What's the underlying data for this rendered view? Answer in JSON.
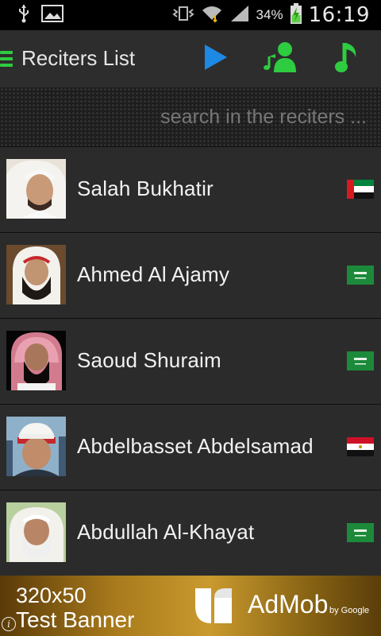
{
  "status_bar": {
    "battery_percent": "34%",
    "time": "16:19",
    "icons": [
      "usb-icon",
      "image-icon",
      "vibrate-icon",
      "wifi-icon",
      "signal-icon",
      "battery-charging-icon"
    ]
  },
  "action_bar": {
    "title": "Reciters List",
    "buttons": [
      "play-icon",
      "reciter-music-icon",
      "music-note-icon"
    ],
    "accent_color": "#2ecc40",
    "play_color": "#1e88e5"
  },
  "search": {
    "placeholder": "search in the reciters ..."
  },
  "reciters": [
    {
      "name": "Salah Bukhatir",
      "flag": "uae-flag-icon"
    },
    {
      "name": "Ahmed Al Ajamy",
      "flag": "saudi-flag-icon"
    },
    {
      "name": "Saoud Shuraim",
      "flag": "saudi-flag-icon"
    },
    {
      "name": "Abdelbasset Abdelsamad",
      "flag": "egypt-flag-icon"
    },
    {
      "name": "Abdullah Al-Khayat",
      "flag": "saudi-flag-icon"
    }
  ],
  "ad": {
    "line1": "320x50",
    "line2": "Test Banner",
    "brand": "AdMob",
    "by": "by Google",
    "info": "i"
  }
}
